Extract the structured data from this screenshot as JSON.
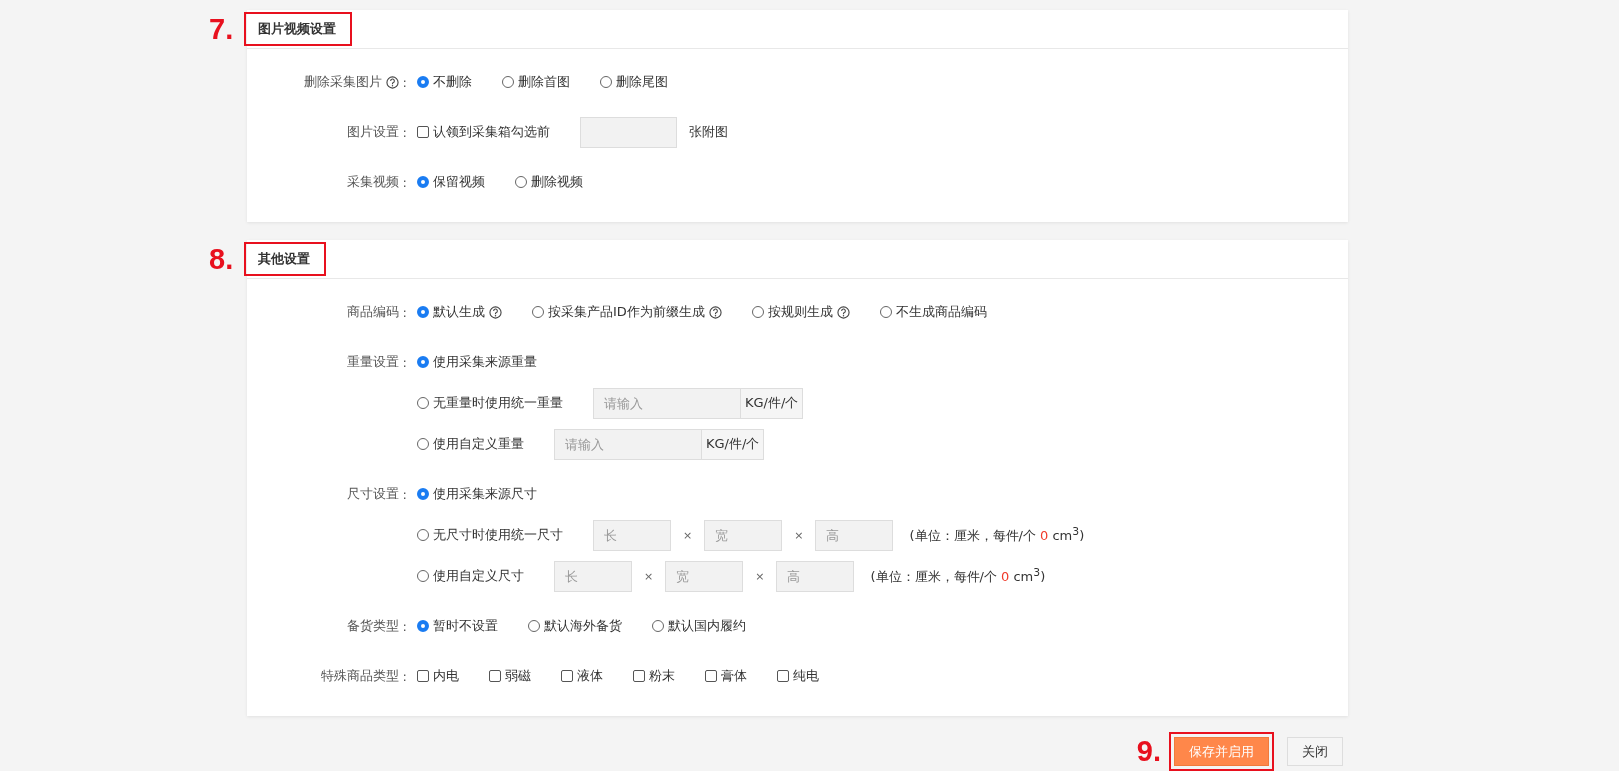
{
  "sections": [
    {
      "marker": "7.",
      "title": "图片视频设置",
      "highlighted": true,
      "colon": ":",
      "rows": [
        {
          "label": "删除采集图片",
          "help": true,
          "lines": [
            [
              {
                "kind": "radio",
                "label": "不删除",
                "selected": true
              },
              {
                "kind": "radio",
                "label": "删除首图",
                "selected": false
              },
              {
                "kind": "radio",
                "label": "删除尾图",
                "selected": false
              }
            ]
          ]
        },
        {
          "label": "图片设置",
          "help": false,
          "lines": [
            [
              {
                "kind": "checkbox",
                "label": "认领到采集箱勾选前",
                "checked": false
              },
              {
                "kind": "field"
              },
              {
                "kind": "text",
                "label": "张附图"
              }
            ]
          ]
        },
        {
          "label": "采集视频",
          "help": false,
          "lines": [
            [
              {
                "kind": "radio",
                "label": "保留视频",
                "selected": true
              },
              {
                "kind": "radio",
                "label": "删除视频",
                "selected": false
              }
            ]
          ]
        }
      ]
    },
    {
      "marker": "8.",
      "title": "其他设置",
      "highlighted": true,
      "colon": ":",
      "rows": [
        {
          "label": "商品编码",
          "help": false,
          "lines": [
            [
              {
                "kind": "radio",
                "label": "默认生成",
                "selected": true,
                "help": true
              },
              {
                "kind": "radio",
                "label": "按采集产品ID作为前缀生成",
                "selected": false,
                "help": true
              },
              {
                "kind": "radio",
                "label": "按规则生成",
                "selected": false,
                "help": true
              },
              {
                "kind": "radio",
                "label": "不生成商品编码",
                "selected": false
              }
            ]
          ]
        },
        {
          "label": "重量设置",
          "help": false,
          "lines": [
            [
              {
                "kind": "radio",
                "label": "使用采集来源重量",
                "selected": true
              }
            ],
            [
              {
                "kind": "radio",
                "label": "无重量时使用统一重量",
                "selected": false
              },
              {
                "kind": "addon-field",
                "placeholder": "请输入",
                "unit": "KG/件/个"
              }
            ],
            [
              {
                "kind": "radio",
                "label": "使用自定义重量",
                "selected": false
              },
              {
                "kind": "addon-field",
                "placeholder": "请输入",
                "unit": "KG/件/个"
              }
            ]
          ]
        },
        {
          "label": "尺寸设置",
          "help": false,
          "lines": [
            [
              {
                "kind": "radio",
                "label": "使用采集来源尺寸",
                "selected": true
              }
            ],
            [
              {
                "kind": "radio",
                "label": "无尺寸时使用统一尺寸",
                "selected": false
              },
              {
                "kind": "dim-field",
                "placeholder": "长"
              },
              {
                "kind": "times",
                "label": "×"
              },
              {
                "kind": "dim-field",
                "placeholder": "宽"
              },
              {
                "kind": "times",
                "label": "×"
              },
              {
                "kind": "dim-field",
                "placeholder": "高"
              },
              {
                "kind": "note",
                "before": "(单位：厘米，每件/个",
                "value": "0",
                "after": "cm$^{3}$)"
              }
            ],
            [
              {
                "kind": "radio",
                "label": "使用自定义尺寸",
                "selected": false
              },
              {
                "kind": "dim-field",
                "placeholder": "长"
              },
              {
                "kind": "times",
                "label": "×"
              },
              {
                "kind": "dim-field",
                "placeholder": "宽"
              },
              {
                "kind": "times",
                "label": "×"
              },
              {
                "kind": "dim-field",
                "placeholder": "高"
              },
              {
                "kind": "note",
                "before": "(单位：厘米，每件/个",
                "value": "0",
                "after": "cm$^{3}$)"
              }
            ]
          ]
        },
        {
          "label": "备货类型",
          "help": false,
          "lines": [
            [
              {
                "kind": "radio",
                "label": "暂时不设置",
                "selected": true
              },
              {
                "kind": "radio",
                "label": "默认海外备货",
                "selected": false
              },
              {
                "kind": "radio",
                "label": "默认国内履约",
                "selected": false
              }
            ]
          ]
        },
        {
          "label": "特殊商品类型",
          "help": false,
          "lines": [
            [
              {
                "kind": "checkbox",
                "label": "内电",
                "checked": false
              },
              {
                "kind": "checkbox",
                "label": "弱磁",
                "checked": false
              },
              {
                "kind": "checkbox",
                "label": "液体",
                "checked": false
              },
              {
                "kind": "checkbox",
                "label": "粉末",
                "checked": false
              },
              {
                "kind": "checkbox",
                "label": "膏体",
                "checked": false
              },
              {
                "kind": "checkbox",
                "label": "纯电",
                "checked": false
              }
            ]
          ]
        }
      ]
    }
  ],
  "footer": {
    "marker": "9.",
    "buttons": [
      {
        "label": "保存并启用",
        "kind": "primary",
        "highlighted": true
      },
      {
        "label": "关闭",
        "kind": "default",
        "highlighted": false
      }
    ]
  }
}
